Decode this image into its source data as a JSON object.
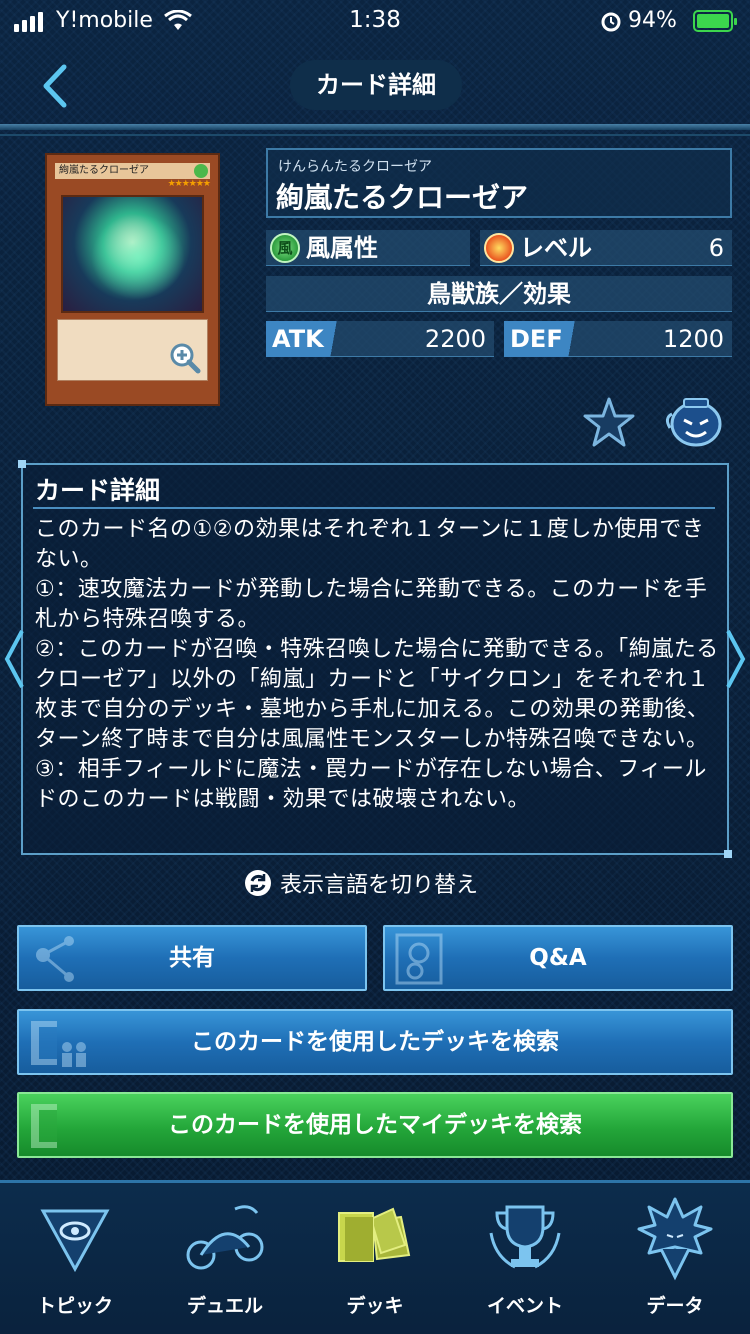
{
  "status_bar": {
    "carrier": "Y!mobile",
    "time": "1:38",
    "battery": "94%",
    "battery_level": 0.94
  },
  "header": {
    "title": "カード詳細"
  },
  "card": {
    "ruby": "けんらんたるクローゼア",
    "name": "絢嵐たるクローゼア",
    "image_name_text": "絢嵐たるクローゼア",
    "attribute": "風属性",
    "attribute_icon_char": "風",
    "level_label": "レベル",
    "level": "6",
    "type": "鳥獣族／効果",
    "atk_label": "ATK",
    "atk": "2200",
    "def_label": "DEF",
    "def": "1200"
  },
  "detail": {
    "title": "カード詳細",
    "text": "このカード名の①②の効果はそれぞれ１ターンに１度しか使用できない。\n①：速攻魔法カードが発動した場合に発動できる。このカードを手札から特殊召喚する。\n②：このカードが召喚・特殊召喚した場合に発動できる。「絢嵐たるクローゼア」以外の「絢嵐」カードと「サイクロン」をそれぞれ１枚まで自分のデッキ・墓地から手札に加える。この効果の発動後、ターン終了時まで自分は風属性モンスターしか特殊召喚できない。\n③：相手フィールドに魔法・罠カードが存在しない場合、フィールドのこのカードは戦闘・効果では破壊されない。"
  },
  "language_toggle": "表示言語を切り替え",
  "buttons": {
    "share": "共有",
    "qa": "Q&A",
    "search_deck": "このカードを使用したデッキを検索",
    "search_my_deck": "このカードを使用したマイデッキを検索"
  },
  "tabs": [
    {
      "label": "トピック",
      "icon": "millennium-eye-icon"
    },
    {
      "label": "デュエル",
      "icon": "duel-runner-icon"
    },
    {
      "label": "デッキ",
      "icon": "deck-cards-icon"
    },
    {
      "label": "イベント",
      "icon": "trophy-icon"
    },
    {
      "label": "データ",
      "icon": "character-icon"
    }
  ],
  "colors": {
    "accent_blue": "#1f6fb6",
    "accent_green": "#24a73a",
    "background": "#0a1f38"
  }
}
